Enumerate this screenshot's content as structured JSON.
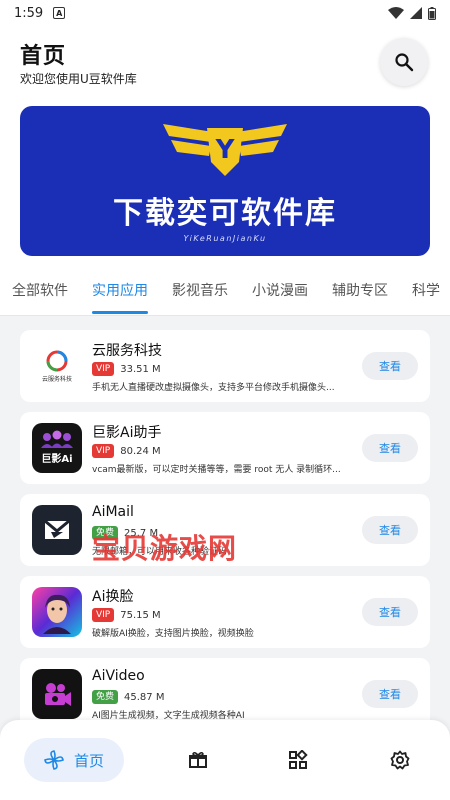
{
  "status": {
    "time": "1:59"
  },
  "header": {
    "title": "首页",
    "subtitle": "欢迎您使用U豆软件库"
  },
  "banner": {
    "headline": "下载奕可软件库",
    "tagline": "YiKeRuanJianKu",
    "badge_letter": "Y"
  },
  "tabs": [
    "全部软件",
    "实用应用",
    "影视音乐",
    "小说漫画",
    "辅助专区",
    "科学"
  ],
  "active_tab": 1,
  "apps": [
    {
      "name": "云服务科技",
      "tag": "VIP",
      "size": "33.51 M",
      "desc": "手机无人直播硬改虚拟摄像头，支持多平台修改手机摄像头...",
      "action": "查看",
      "icon": "cloud-service-logo-icon"
    },
    {
      "name": "巨影Ai助手",
      "tag": "VIP",
      "size": "80.24 M",
      "desc": "vcam最新版，可以定时关播等等，需要 root 无人 录制循环...",
      "action": "查看",
      "icon": "juying-ai-logo-icon"
    },
    {
      "name": "AiMail",
      "tag": "免费",
      "size": "25.7 M",
      "desc": "无限邮箱，可以用来收各种验证码",
      "action": "查看",
      "icon": "aimail-logo-icon"
    },
    {
      "name": "Ai换脸",
      "tag": "VIP",
      "size": "75.15 M",
      "desc": "破解版AI换脸，支持图片换脸，视频换脸",
      "action": "查看",
      "icon": "ai-faceswap-logo-icon"
    },
    {
      "name": "AiVideo",
      "tag": "免费",
      "size": "45.87 M",
      "desc": "AI图片生成视频，文字生成视频各种AI",
      "action": "查看",
      "icon": "aivideo-logo-icon"
    }
  ],
  "watermark": "宝贝游戏网",
  "nav": {
    "home_label": "首页"
  },
  "colors": {
    "accent": "#1e88e5",
    "vip": "#e53935",
    "free": "#43a047",
    "banner": "#1b2fb6"
  }
}
